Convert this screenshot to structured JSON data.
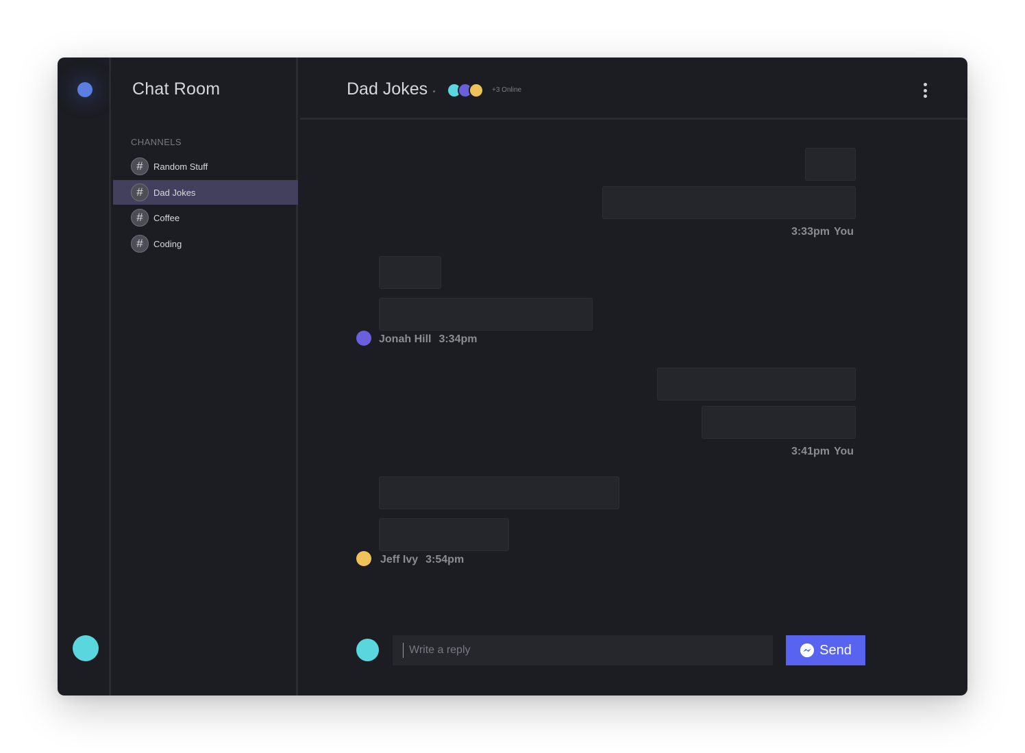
{
  "app": {
    "title": "Chat Room"
  },
  "sidebar": {
    "section_label": "CHANNELS",
    "channels": [
      {
        "label": "Random Stuff",
        "active": false
      },
      {
        "label": "Dad Jokes",
        "active": true
      },
      {
        "label": "Coffee",
        "active": false
      },
      {
        "label": "Coding",
        "active": false
      }
    ]
  },
  "header": {
    "channel_title": "Dad Jokes",
    "online_count": "+3 Online",
    "online_avatar_colors": [
      "#5ad6df",
      "#6a5fdc",
      "#efc35a"
    ]
  },
  "messages": [
    {
      "author": "You",
      "time": "3:33pm",
      "side": "right",
      "bubble_count": 2
    },
    {
      "author": "Jonah Hill",
      "time": "3:34pm",
      "side": "left",
      "avatar_color": "#6a5fdc",
      "bubble_count": 2
    },
    {
      "author": "You",
      "time": "3:41pm",
      "side": "right",
      "bubble_count": 2
    },
    {
      "author": "Jeff Ivy",
      "time": "3:54pm",
      "side": "left",
      "avatar_color": "#efc35a",
      "bubble_count": 2
    }
  ],
  "composer": {
    "placeholder": "Write a reply",
    "value": "",
    "send_label": "Send",
    "avatar_color": "#5ad6df"
  },
  "colors": {
    "background": "#1c1d22",
    "accent": "#5863f0",
    "active_channel": "#43405e",
    "rail_dot": "#5a7fe0"
  },
  "icons": {
    "channel": "hash-icon",
    "more": "more-vertical-icon",
    "send": "messenger-icon"
  }
}
